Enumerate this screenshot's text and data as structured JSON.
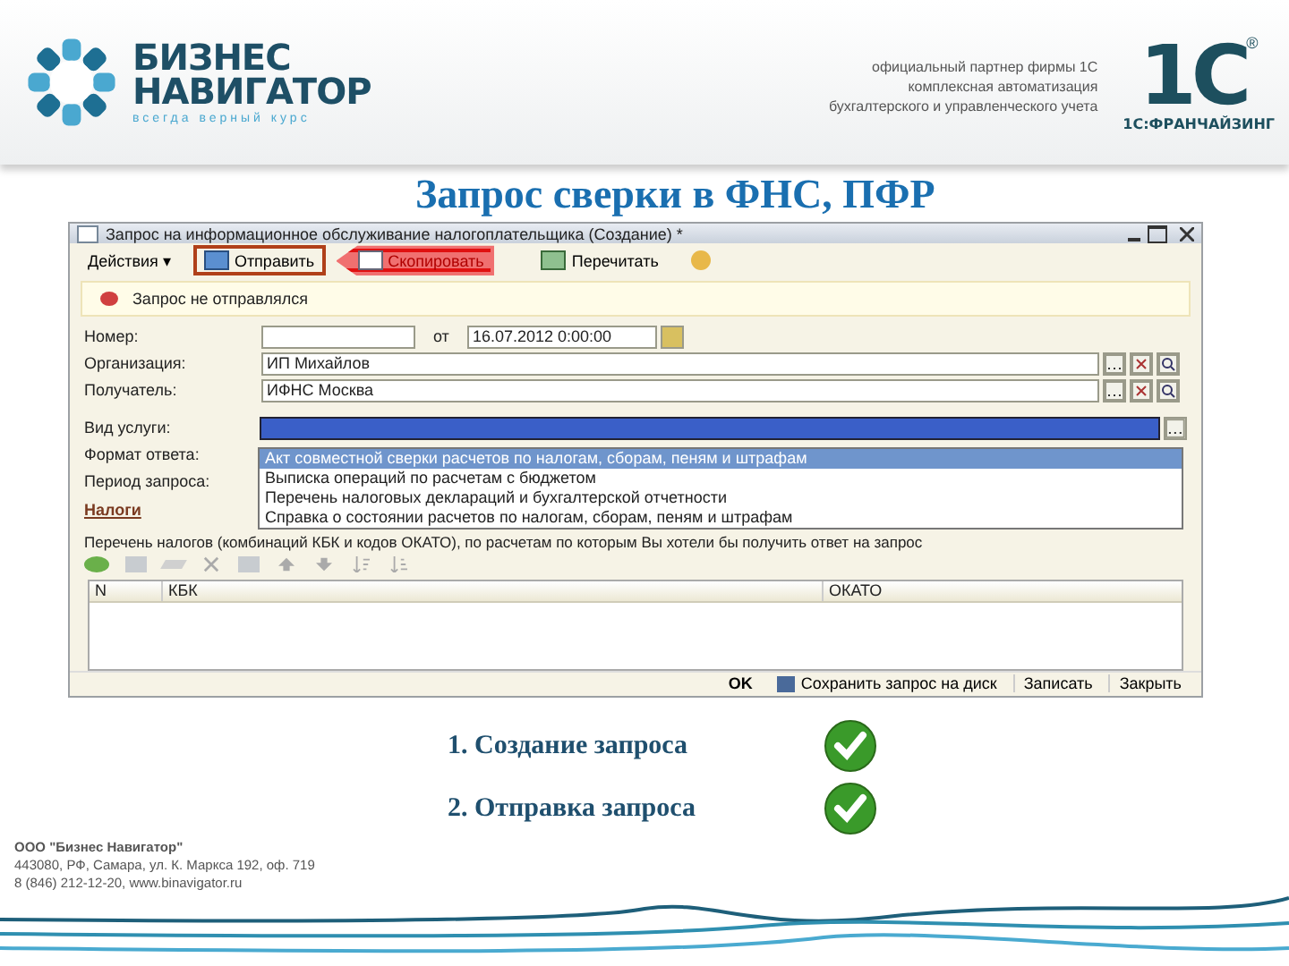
{
  "header": {
    "logo_line1": "БИЗНЕС",
    "logo_line2": "НАВИГАТОР",
    "logo_slogan": "всегда верный курс",
    "partner_lines": [
      "официальный партнер фирмы 1С",
      "комплексная автоматизация",
      "бухгалтерского и управленческого учета"
    ],
    "brand_logo": "1С",
    "brand_mark": "®",
    "brand_caption": "1С:ФРАНЧАЙЗИНГ"
  },
  "slide_title": "Запрос сверки в ФНС, ПФР",
  "window": {
    "title": "Запрос на информационное обслуживание налогоплательщика (Создание) *",
    "toolbar": [
      {
        "label": "Действия ▾",
        "kind": "menu",
        "highlighted": false,
        "pointed_at": false
      },
      {
        "label": "Отправить",
        "kind": "send",
        "highlighted": true,
        "pointed_at": false
      },
      {
        "label": "Скопировать",
        "kind": "copy",
        "highlighted": false,
        "pointed_at": true
      },
      {
        "label": "Перечитать",
        "kind": "reload",
        "highlighted": false,
        "pointed_at": false
      },
      {
        "kind": "help",
        "highlighted": false,
        "pointed_at": false
      }
    ],
    "status_message": "Запрос не отправлялся",
    "number_label": "Номер:",
    "date_sep": "от",
    "date_value": "16.07.2012  0:00:00",
    "org_label": "Организация:",
    "org_value": "ИП Михайлов",
    "recipient_label": "Получатель:",
    "recipient_value": "ИФНС Москва",
    "service_label": "Вид услуги:",
    "format_label": "Формат ответа:",
    "period_label": "Период запроса:",
    "service_options": [
      {
        "label": "Акт совместной сверки расчетов по налогам, сборам, пеням и штрафам",
        "selected": true
      },
      {
        "label": "Выписка операций по расчетам с бюджетом",
        "selected": false
      },
      {
        "label": "Перечень налоговых деклараций и бухгалтерской отчетности",
        "selected": false
      },
      {
        "label": "Справка о состоянии расчетов по налогам, сборам, пеням и штрафам",
        "selected": false
      }
    ],
    "taxes_header": "Налоги",
    "taxes_hint": "Перечень налогов (комбинаций КБК и кодов ОКАТО), по расчетам по которым Вы хотели бы получить ответ на запрос",
    "columns": [
      "N",
      "КБК",
      "ОКАТО"
    ],
    "footer_buttons": [
      {
        "label": "OK",
        "kind": "ok"
      },
      {
        "label": "Сохранить запрос на диск",
        "kind": "save"
      },
      {
        "label": "Записать",
        "kind": "plain"
      },
      {
        "label": "Закрыть",
        "kind": "plain"
      }
    ]
  },
  "steps": [
    {
      "text": "1. Создание запроса",
      "done": true
    },
    {
      "text": "2. Отправка запроса",
      "done": true
    }
  ],
  "footer_lines": [
    "ООО \"Бизнес Навигатор\"",
    "443080, РФ, Самара, ул. К. Маркса 192, оф. 719",
    "8 (846) 212-12-20, www.binavigator.ru"
  ]
}
